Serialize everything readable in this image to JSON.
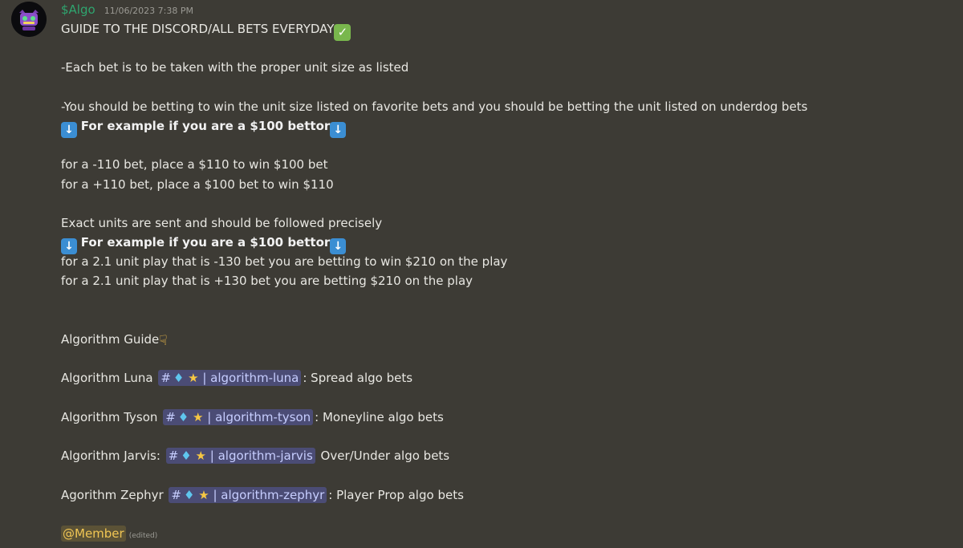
{
  "message": {
    "username": "$Algo",
    "timestamp": "11/06/2023 7:38 PM",
    "avatar_icon": "robot-mascot-icon",
    "accent_colors": {
      "username": "#2fa56f",
      "channel_bg": "#4b4c75",
      "channel_text": "#c7ceff",
      "mention_bg": "#5b5236",
      "mention_text": "#f1c654"
    },
    "title": "GUIDE TO THE DISCORD/ALL BETS EVERYDAY",
    "line_unit_size": "-Each bet is to be taken with the proper unit size as listed",
    "line_win_unit": "-You should be betting to win the unit size listed on favorite bets and you should be betting the unit listed on underdog bets",
    "example_label_1": "For example if you are a $100 bettor",
    "line_minus_110": "for a -110 bet, place a $110 to win $100 bet",
    "line_plus_110": "for a +110 bet, place a $100 bet to win $110",
    "line_exact_units": "Exact units are sent and should be followed precisely",
    "example_label_2": "For example if you are a $100 bettor",
    "line_minus_130": "for a 2.1 unit play that is -130 bet you are betting to win $210 on the play",
    "line_plus_130": "for a 2.1 unit play that is +130 bet you are betting $210 on the play",
    "algorithm_guide_title": "Algorithm Guide",
    "algorithms": [
      {
        "name": "Algorithm Luna",
        "channel": "algorithm-luna",
        "desc": ": Spread algo bets"
      },
      {
        "name": "Algorithm Tyson",
        "channel": "algorithm-tyson",
        "desc": ": Moneyline algo bets"
      },
      {
        "name": "Algorithm Jarvis:",
        "channel": "algorithm-jarvis",
        "desc": " Over/Under algo bets"
      },
      {
        "name": "Agorithm Zephyr",
        "channel": "algorithm-zephyr",
        "desc": ": Player Prop algo bets"
      }
    ],
    "mention": "@Member",
    "edited_label": "(edited)"
  }
}
